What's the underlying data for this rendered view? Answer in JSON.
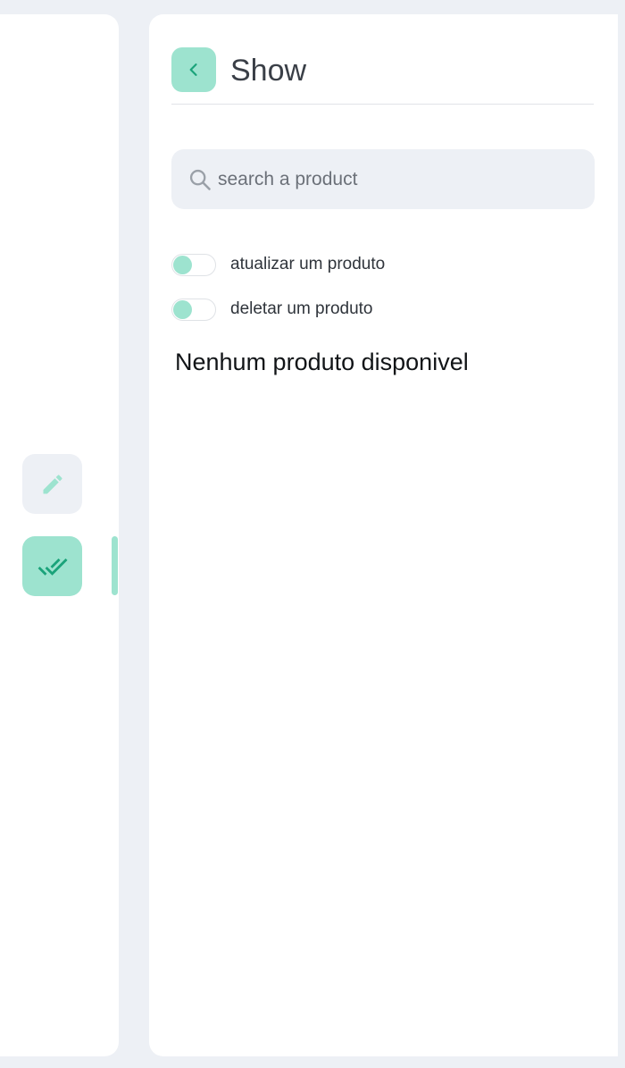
{
  "sidebar": {
    "items": [
      {
        "icon": "pencil-icon",
        "active": false
      },
      {
        "icon": "double-check-icon",
        "active": true
      }
    ]
  },
  "header": {
    "back_icon": "chevron-left-icon",
    "title": "Show"
  },
  "search": {
    "placeholder": "search a product",
    "value": "",
    "icon": "search-icon"
  },
  "toggles": [
    {
      "label": "atualizar um produto",
      "on": false
    },
    {
      "label": "deletar um produto",
      "on": false
    }
  ],
  "content": {
    "empty_message": "Nenhum produto disponivel"
  },
  "colors": {
    "accent": "#9de3cf",
    "accent_dark": "#1aa37a",
    "background": "#edf0f5"
  }
}
